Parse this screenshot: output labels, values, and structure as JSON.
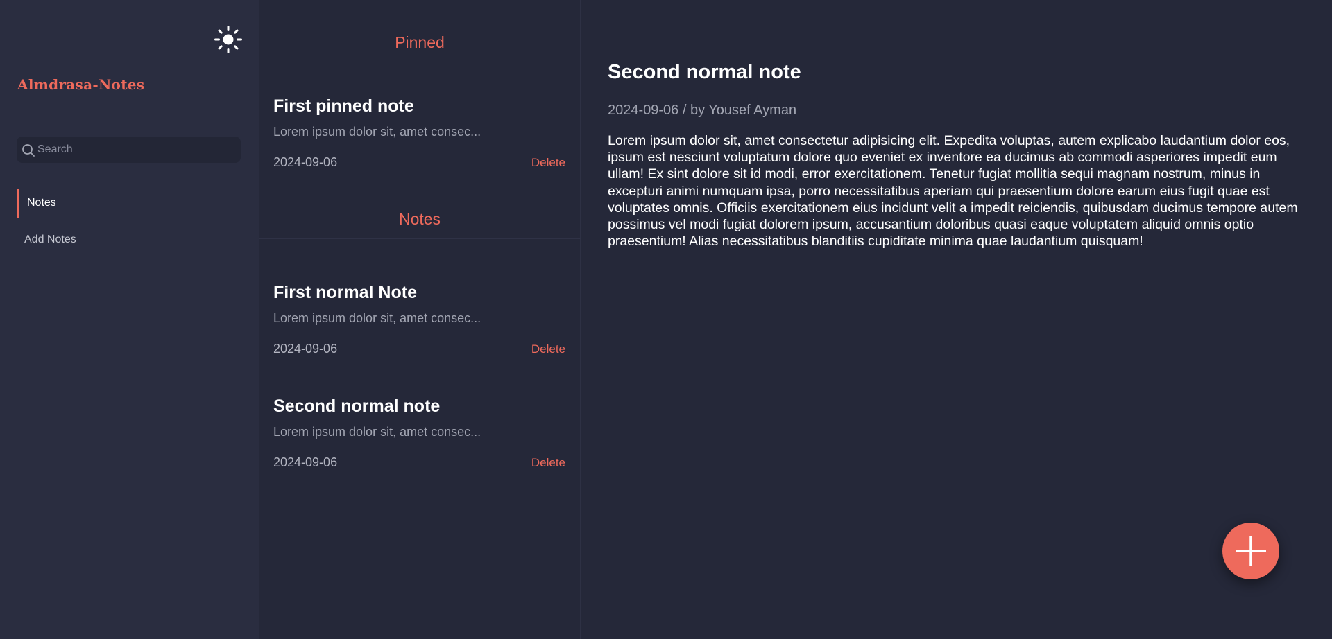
{
  "sidebar": {
    "brand": "Almdrasa-Notes",
    "theme_icon": "sun-icon",
    "search": {
      "placeholder": "Search",
      "value": ""
    },
    "nav": [
      {
        "label": "Notes",
        "active": true
      },
      {
        "label": "Add Notes",
        "active": false
      }
    ]
  },
  "list": {
    "pinned_heading": "Pinned",
    "notes_heading": "Notes",
    "pinned": [
      {
        "title": "First pinned note",
        "excerpt": "Lorem ipsum dolor sit, amet consec...",
        "date": "2024-09-06",
        "delete_label": "Delete"
      }
    ],
    "notes": [
      {
        "title": "First normal Note",
        "excerpt": "Lorem ipsum dolor sit, amet consec...",
        "date": "2024-09-06",
        "delete_label": "Delete"
      },
      {
        "title": "Second normal note",
        "excerpt": "Lorem ipsum dolor sit, amet consec...",
        "date": "2024-09-06",
        "delete_label": "Delete"
      }
    ]
  },
  "detail": {
    "title": "Second normal note",
    "meta": "2024-09-06 / by Yousef Ayman",
    "body": "Lorem ipsum dolor sit, amet consectetur adipisicing elit. Expedita voluptas, autem explicabo laudantium dolor eos, ipsum est nesciunt voluptatum dolore quo eveniet ex inventore ea ducimus ab commodi asperiores impedit eum ullam! Ex sint dolore sit id modi, error exercitationem. Tenetur fugiat mollitia sequi magnam nostrum, minus in excepturi animi numquam ipsa, porro necessitatibus aperiam qui praesentium dolore earum eius fugit quae est voluptates omnis. Officiis exercitationem eius incidunt velit a impedit reiciendis, quibusdam ducimus tempore autem possimus vel modi fugiat dolorem ipsum, accusantium doloribus quasi eaque voluptatem aliquid omnis optio praesentium! Alias necessitatibus blanditiis cupiditate minima quae laudantium quisquam!"
  },
  "fab": {
    "icon": "plus-icon"
  },
  "colors": {
    "accent": "#ee6a5c",
    "sidebar_bg": "#2a2d40",
    "main_bg": "#252839",
    "text": "#ffffff",
    "muted": "#a3a6b3"
  }
}
